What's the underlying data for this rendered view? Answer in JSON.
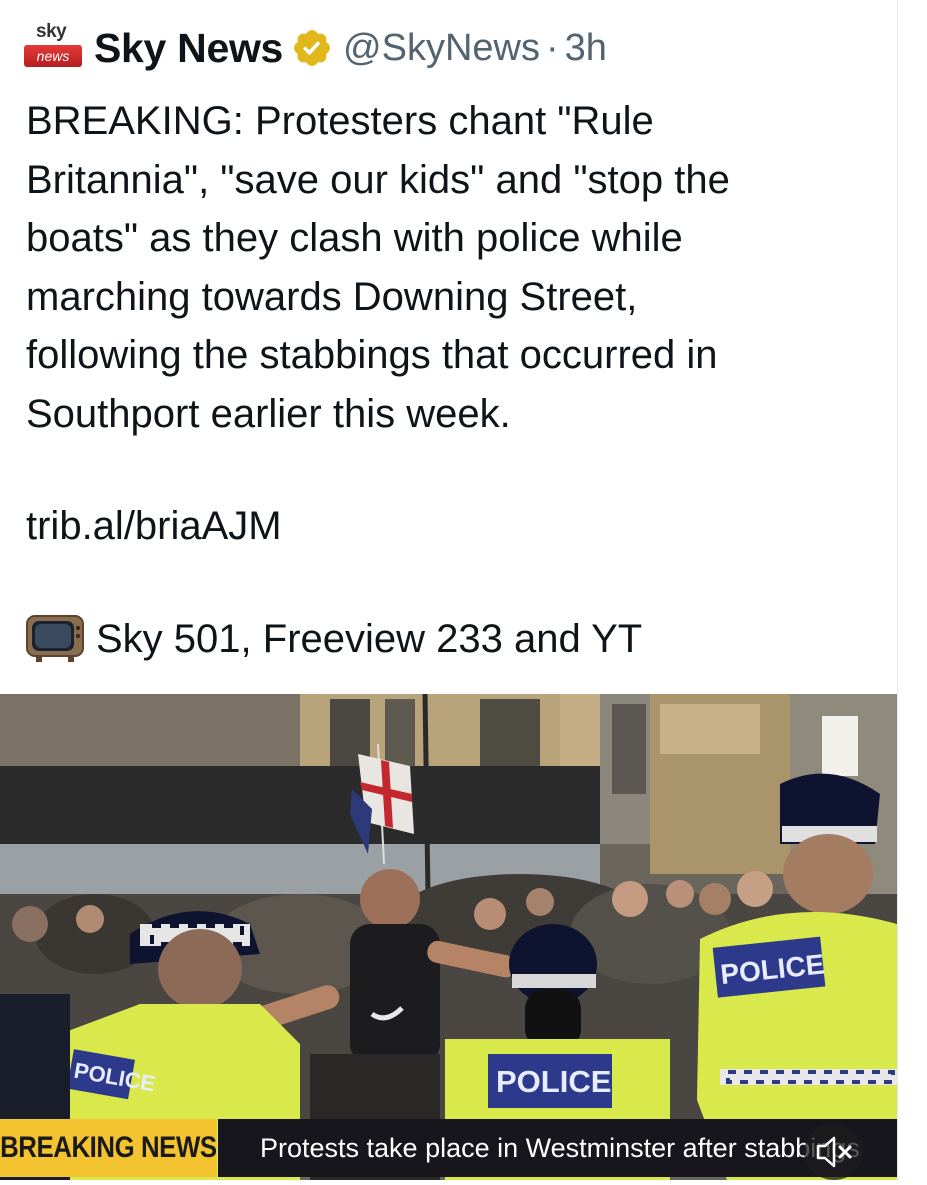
{
  "tweet": {
    "author": {
      "avatar_sky": "sky",
      "avatar_news": "news",
      "display_name": "Sky News",
      "handle": "@SkyNews",
      "separator": "·",
      "time": "3h"
    },
    "body_lines": [
      "BREAKING: Protesters chant \"Rule",
      "Britannia\", \"save our kids\" and \"stop the",
      "boats\" as they clash with police while",
      "marching towards Downing Street,",
      "following the stabbings that occurred in",
      "Southport earlier this week."
    ],
    "link": "trib.al/briaAJM",
    "tv_line": "Sky 501, Freeview 233 and YT",
    "tv_icon": "television-icon"
  },
  "media": {
    "banner_label": "BREAKING NEWS",
    "banner_ticker": "Protests take place in Westminster after stabbings",
    "police_label_left": "POLICE",
    "police_label_center": "POLICE",
    "police_label_right": "POLICE",
    "mute_icon": "muted-speaker-icon"
  },
  "colors": {
    "verified_gold": "#e2b719",
    "banner_yellow": "#f4c430",
    "hi_vis": "#d9e84a",
    "police_blue": "#2d3a8c"
  }
}
